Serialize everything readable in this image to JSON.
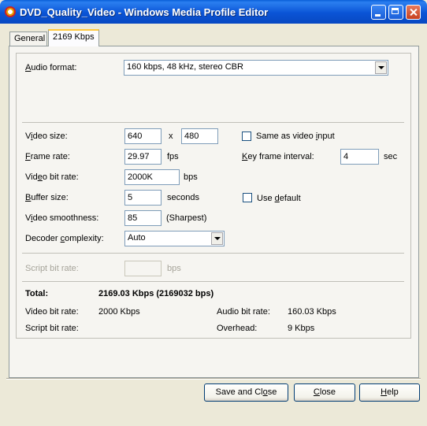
{
  "window": {
    "title": "DVD_Quality_Video - Windows Media Profile Editor",
    "controls": [
      "minimize",
      "maximize",
      "close"
    ]
  },
  "tabs": [
    {
      "label": "General",
      "active": false
    },
    {
      "label": "2169 Kbps",
      "active": true
    }
  ],
  "audio": {
    "label_pre": "",
    "label_u": "A",
    "label_post": "udio format:",
    "value": "160 kbps, 48 kHz, stereo CBR"
  },
  "video": {
    "size_label_pre": "V",
    "size_label_u": "i",
    "size_label_post": "deo size:",
    "width": "640",
    "times": "x",
    "height": "480",
    "same_as_input_pre": "Same as video ",
    "same_as_input_u": "i",
    "same_as_input_post": "nput",
    "same_as_input_checked": false,
    "frame_rate_label_u": "F",
    "frame_rate_label_post": "rame rate:",
    "frame_rate": "29.97",
    "frame_rate_unit": "fps",
    "key_frame_label_u": "K",
    "key_frame_label_post": "ey frame interval:",
    "key_frame": "4",
    "key_frame_unit": "sec",
    "bit_rate_label_pre": "Vid",
    "bit_rate_label_u": "e",
    "bit_rate_label_post": "o bit rate:",
    "bit_rate": "2000K",
    "bit_rate_unit": "bps",
    "buffer_label_u": "B",
    "buffer_label_post": "uffer size:",
    "buffer": "5",
    "buffer_unit": "seconds",
    "use_default_pre": "Use ",
    "use_default_u": "d",
    "use_default_post": "efault",
    "use_default_checked": false,
    "smoothness_label_pre": "V",
    "smoothness_label_u": "i",
    "smoothness_label_post": "deo smoothness:",
    "smoothness": "85",
    "smoothness_note": "(Sharpest)",
    "decoder_label_pre": "Decoder ",
    "decoder_label_u": "c",
    "decoder_label_post": "omplexity:",
    "decoder": "Auto"
  },
  "script": {
    "label": "Script bit rate:",
    "value": "",
    "unit": "bps"
  },
  "summary": {
    "total_label": "Total:",
    "total_value": "2169.03 Kbps (2169032 bps)",
    "video_bit_rate_label": "Video bit rate:",
    "video_bit_rate": "2000 Kbps",
    "audio_bit_rate_label": "Audio bit rate:",
    "audio_bit_rate": "160.03 Kbps",
    "script_bit_rate_label": "Script bit rate:",
    "script_bit_rate": "",
    "overhead_label": "Overhead:",
    "overhead": "9 Kbps"
  },
  "buttons": {
    "save_close_pre": "Save and Cl",
    "save_close_u": "o",
    "save_close_post": "se",
    "close_u": "C",
    "close_post": "lose",
    "help_u": "H",
    "help_post": "elp"
  }
}
